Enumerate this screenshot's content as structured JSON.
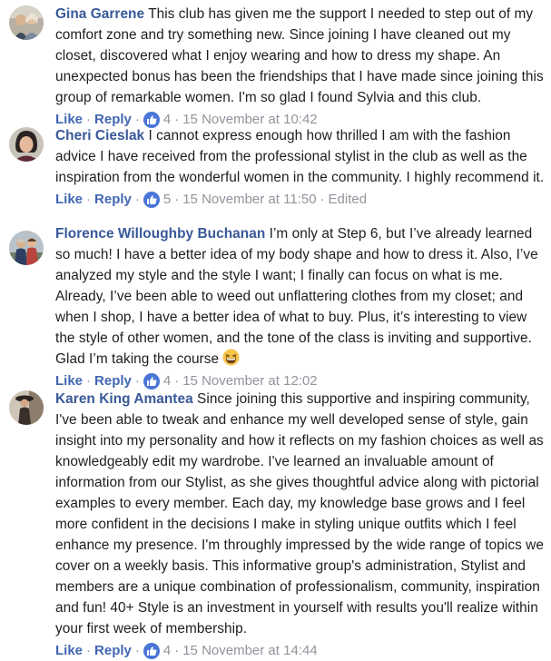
{
  "comments": [
    {
      "author": "Gina Garrene",
      "text": "This club has given me the support I needed to step out of my comfort zone and try something new. Since joining I have cleaned out my closet, discovered what I enjoy wearing and how to dress my shape. An unexpected bonus has been the friendships that I have made since joining this group of remarkable women. I'm so glad I found Sylvia and this club.",
      "like_label": "Like",
      "reply_label": "Reply",
      "reactions": "4",
      "timestamp": "15 November at 10:42",
      "edited": ""
    },
    {
      "author": "Cheri Cieslak",
      "text": "I cannot express enough how thrilled I am with the fashion advice I have received from the professional stylist in the club as well as the inspiration from the wonderful women in the community. I highly recommend it.",
      "like_label": "Like",
      "reply_label": "Reply",
      "reactions": "5",
      "timestamp": "15 November at 11:50",
      "edited": "Edited"
    },
    {
      "author": "Florence Willoughby Buchanan",
      "text": "I’m only at Step 6, but I’ve already learned so much! I have a better idea of my body shape and how to dress it. Also, I’ve analyzed my style and the style I want; I finally can focus on what is me. Already, I’ve been able to weed out unflattering clothes from my closet; and when I shop, I have a better idea of what to buy. Plus, it’s interesting to view the style of other women, and the tone of the class is inviting and supportive. Glad I’m taking the course",
      "emoji": "grinning-squinting-face",
      "like_label": "Like",
      "reply_label": "Reply",
      "reactions": "4",
      "timestamp": "15 November at 12:02",
      "edited": ""
    },
    {
      "author": "Karen King Amantea",
      "text": "Since joining this supportive and inspiring community, I've been able to tweak and enhance my well developed sense of style, gain insight into my personality and how it reflects on my fashion choices as well as knowledgeably edit my wardrobe. I've learned an invaluable amount of information from our Stylist, as she gives thoughtful advice along with pictorial examples to every member. Each day, my knowledge base grows and I feel more confident in the decisions I make in styling unique outfits which I feel enhance my presence. I'm throughly impressed by the wide range of topics we cover on a weekly basis. This informative group's administration, Stylist and members are a unique combination of professionalism, community, inspiration and fun! 40+ Style is an investment in yourself with results you'll realize within your first week of membership.",
      "like_label": "Like",
      "reply_label": "Reply",
      "reactions": "4",
      "timestamp": "15 November at 14:44",
      "edited": ""
    }
  ],
  "separator": "·",
  "colors": {
    "author": "#385898",
    "action_link": "#4267b2",
    "meta": "#90949c",
    "text": "#1c1e21",
    "like_badge": "#4a76d8"
  }
}
